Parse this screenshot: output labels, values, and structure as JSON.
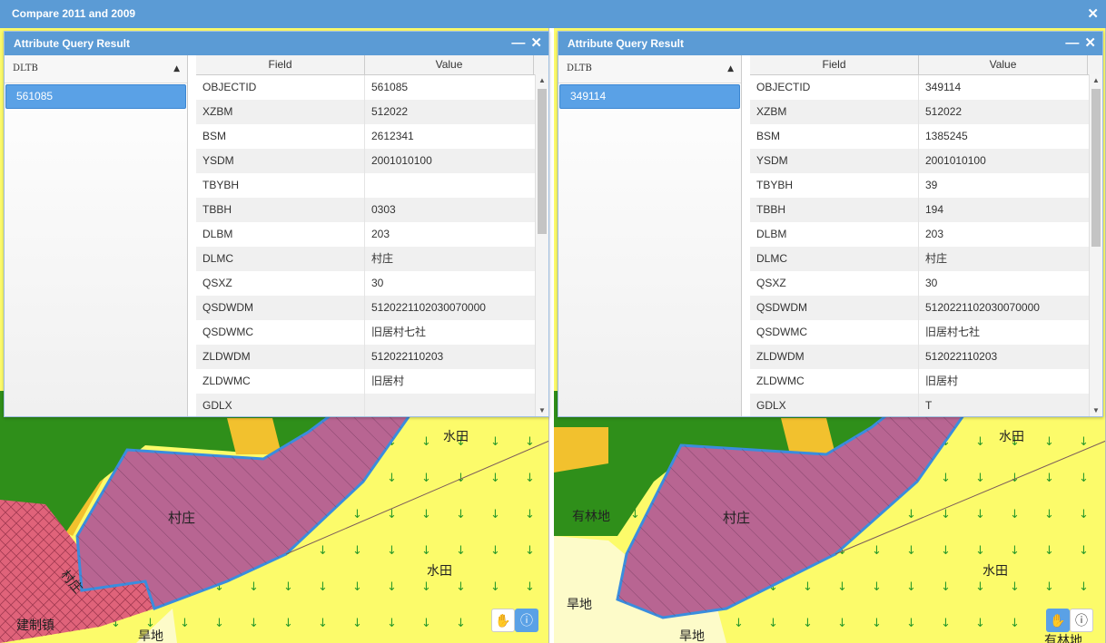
{
  "window": {
    "title": "Compare 2011 and 2009"
  },
  "left": {
    "panel_title": "Attribute Query Result",
    "list_header": "DLTB",
    "list_items": [
      "561085"
    ],
    "columns": {
      "field": "Field",
      "value": "Value"
    },
    "rows": [
      {
        "field": "OBJECTID",
        "value": "561085"
      },
      {
        "field": "XZBM",
        "value": "512022"
      },
      {
        "field": "BSM",
        "value": "2612341"
      },
      {
        "field": "YSDM",
        "value": "2001010100"
      },
      {
        "field": "TBYBH",
        "value": ""
      },
      {
        "field": "TBBH",
        "value": "0303"
      },
      {
        "field": "DLBM",
        "value": "203"
      },
      {
        "field": "DLMC",
        "value": "村庄"
      },
      {
        "field": "QSXZ",
        "value": "30"
      },
      {
        "field": "QSDWDM",
        "value": "5120221102030070000"
      },
      {
        "field": "QSDWMC",
        "value": "旧居村七社"
      },
      {
        "field": "ZLDWDM",
        "value": "512022110203"
      },
      {
        "field": "ZLDWMC",
        "value": "旧居村"
      },
      {
        "field": "GDLX",
        "value": ""
      }
    ],
    "map_labels": {
      "a": "村庄",
      "b": "水田",
      "c": "水田",
      "d": "村庄",
      "e": "建制镇",
      "f": "旱地"
    }
  },
  "right": {
    "panel_title": "Attribute Query Result",
    "list_header": "DLTB",
    "list_items": [
      "349114"
    ],
    "columns": {
      "field": "Field",
      "value": "Value"
    },
    "rows": [
      {
        "field": "OBJECTID",
        "value": "349114"
      },
      {
        "field": "XZBM",
        "value": "512022"
      },
      {
        "field": "BSM",
        "value": "1385245"
      },
      {
        "field": "YSDM",
        "value": "2001010100"
      },
      {
        "field": "TBYBH",
        "value": "39"
      },
      {
        "field": "TBBH",
        "value": "194"
      },
      {
        "field": "DLBM",
        "value": "203"
      },
      {
        "field": "DLMC",
        "value": "村庄"
      },
      {
        "field": "QSXZ",
        "value": "30"
      },
      {
        "field": "QSDWDM",
        "value": "5120221102030070000"
      },
      {
        "field": "QSDWMC",
        "value": "旧居村七社"
      },
      {
        "field": "ZLDWDM",
        "value": "512022110203"
      },
      {
        "field": "ZLDWMC",
        "value": "旧居村"
      },
      {
        "field": "GDLX",
        "value": "T"
      }
    ],
    "map_labels": {
      "a": "村庄",
      "b": "水田",
      "c": "水田",
      "d": "有林地",
      "e": "旱地",
      "f": "旱地",
      "g": "有林地"
    }
  },
  "colors": {
    "header": "#5b9bd5",
    "village": "#b86592",
    "paddy": "#fcfb6a",
    "forest": "#2f8f1a",
    "town": "#e0637a",
    "dry": "#fdfbc9",
    "orchard": "#f2c12e",
    "selection": "#5aa1e6"
  },
  "icons": {
    "pan": "hand-icon",
    "identify": "info-icon",
    "close": "close-icon",
    "minimize": "minimize-icon"
  }
}
